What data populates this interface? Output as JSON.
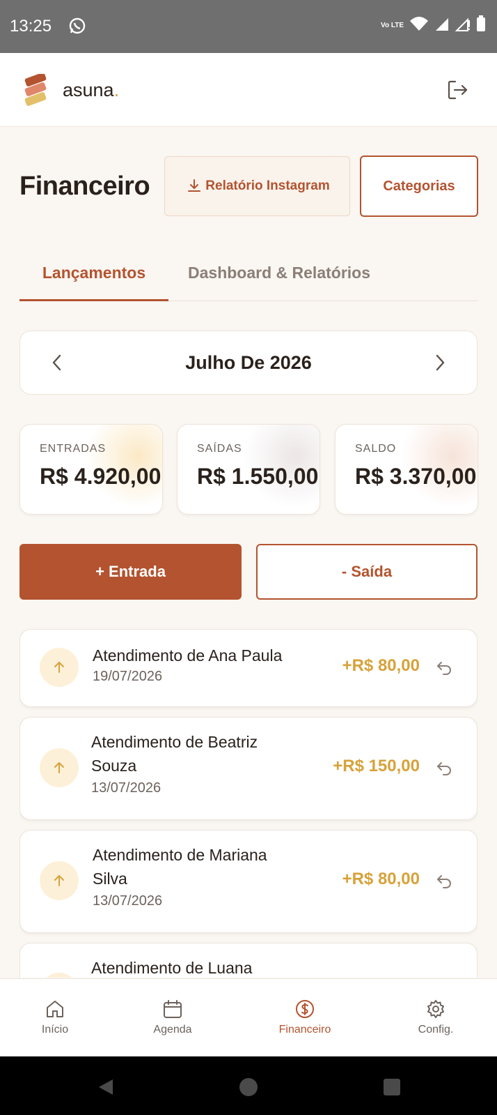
{
  "status_bar": {
    "time": "13:25",
    "network": "Vo LTE"
  },
  "header": {
    "brand": "asuna",
    "brand_dot": "."
  },
  "page": {
    "title": "Financeiro",
    "report_button": "Relatório Instagram",
    "categories_button": "Categorias"
  },
  "tabs": [
    {
      "label": "Lançamentos",
      "active": true
    },
    {
      "label": "Dashboard & Relatórios",
      "active": false
    }
  ],
  "month_selector": {
    "label": "Julho De 2026"
  },
  "summary": [
    {
      "label": "ENTRADAS",
      "value": "R$ 4.920,00",
      "accent": "#fbe9c6"
    },
    {
      "label": "SAÍDAS",
      "value": "R$ 1.550,00",
      "accent": "#ece6e6"
    },
    {
      "label": "SALDO",
      "value": "R$ 3.370,00",
      "accent": "#f6e3d8"
    }
  ],
  "actions": {
    "income": "+ Entrada",
    "expense": "- Saída"
  },
  "transactions": [
    {
      "title": "Atendimento de Ana Paula",
      "date": "19/07/2026",
      "amount": "+R$ 80,00"
    },
    {
      "title": "Atendimento de Beatriz Souza",
      "date": "13/07/2026",
      "amount": "+R$ 150,00"
    },
    {
      "title": "Atendimento de Mariana Silva",
      "date": "13/07/2026",
      "amount": "+R$ 80,00"
    },
    {
      "title": "Atendimento de Luana",
      "date": "",
      "amount": ""
    }
  ],
  "bottom_nav": [
    {
      "label": "Início",
      "icon": "home-icon"
    },
    {
      "label": "Agenda",
      "icon": "calendar-icon"
    },
    {
      "label": "Financeiro",
      "icon": "dollar-icon",
      "active": true
    },
    {
      "label": "Config.",
      "icon": "gear-icon"
    }
  ],
  "colors": {
    "primary": "#b3532f",
    "income": "#d7a23a",
    "background": "#faf6f1"
  }
}
